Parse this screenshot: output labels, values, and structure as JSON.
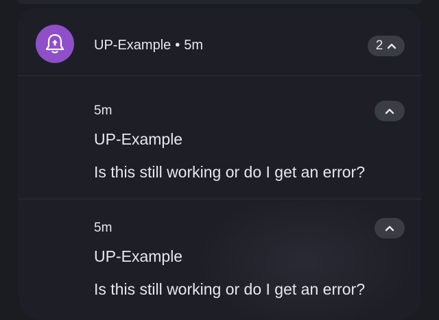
{
  "header": {
    "app_name": "UP-Example",
    "separator": "•",
    "time": "5m",
    "count": "2",
    "app_icon": "bell-upload-icon",
    "collapse_icon": "chevron-up-icon"
  },
  "notifications": [
    {
      "time": "5m",
      "title": "UP-Example",
      "body": "Is this still working or do I get an error?",
      "expand_icon": "chevron-up-icon"
    },
    {
      "time": "5m",
      "title": "UP-Example",
      "body": "Is this still working or do I get an error?",
      "expand_icon": "chevron-up-icon"
    }
  ],
  "colors": {
    "background": "#1b1c22",
    "panel": "#1e1f26",
    "pill": "#3b3d44",
    "app_icon_bg": "#8f4fc8",
    "text": "#e7e8ee"
  }
}
